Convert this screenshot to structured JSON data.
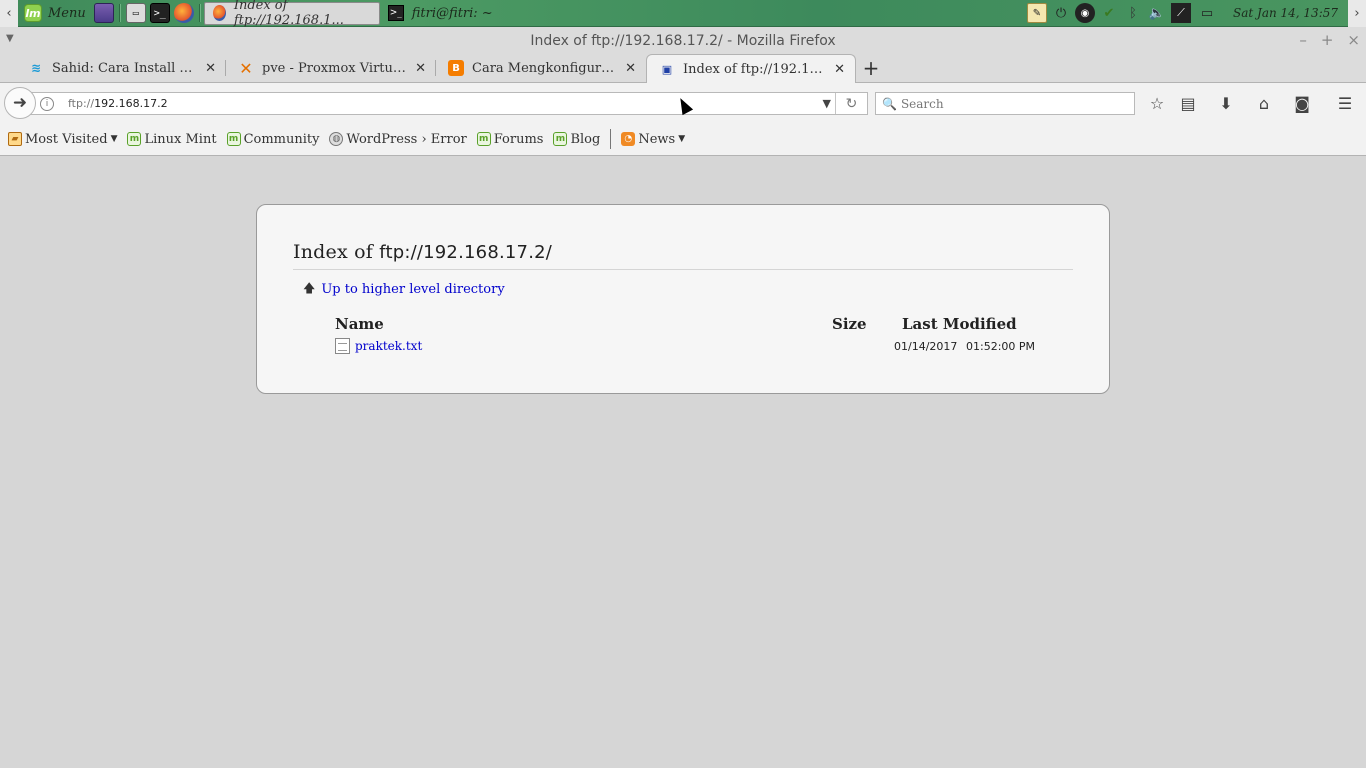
{
  "panel": {
    "menu_label": "Menu",
    "tasks": [
      {
        "label": "Index of ftp://192.168.1..."
      },
      {
        "label": "fitri@fitri: ~"
      }
    ],
    "clock": "Sat Jan 14, 13:57"
  },
  "window": {
    "title": "Index of ftp://192.168.17.2/ - Mozilla Firefox"
  },
  "tabs": [
    {
      "label": "Sahid: Cara Install Dan ...",
      "icon": "zeta-icon",
      "color": "#1a9ad6"
    },
    {
      "label": "pve - Proxmox Virtual E...",
      "icon": "proxmox-icon",
      "color": "#e57000"
    },
    {
      "label": "Cara Mengkonfigurasi FT...",
      "icon": "blogger-icon",
      "color": "#f57d00"
    },
    {
      "label": "Index of ftp://192.168.17.2/",
      "icon": "ftp-icon",
      "color": "#1f3fa6"
    }
  ],
  "navbar": {
    "url_scheme": "ftp://",
    "url_host": "192.168.17.2",
    "search_placeholder": "Search"
  },
  "bookmarks": [
    {
      "label": "Most Visited",
      "icon": "folder-icon",
      "dropdown": true
    },
    {
      "label": "Linux Mint",
      "icon": "mint-icon"
    },
    {
      "label": "Community",
      "icon": "mint-icon"
    },
    {
      "label": "WordPress › Error",
      "icon": "globe-icon"
    },
    {
      "label": "Forums",
      "icon": "mint-icon"
    },
    {
      "label": "Blog",
      "icon": "mint-icon"
    },
    {
      "label": "News",
      "icon": "rss-icon",
      "dropdown": true
    }
  ],
  "listing": {
    "heading_prefix": "Index of",
    "heading_path": "ftp://192.168.17.2/",
    "up_link": "Up to higher level directory",
    "columns": {
      "name": "Name",
      "size": "Size",
      "modified": "Last Modified"
    },
    "files": [
      {
        "name": "praktek.txt",
        "size": "",
        "date": "01/14/2017",
        "time": "01:52:00 PM"
      }
    ]
  }
}
